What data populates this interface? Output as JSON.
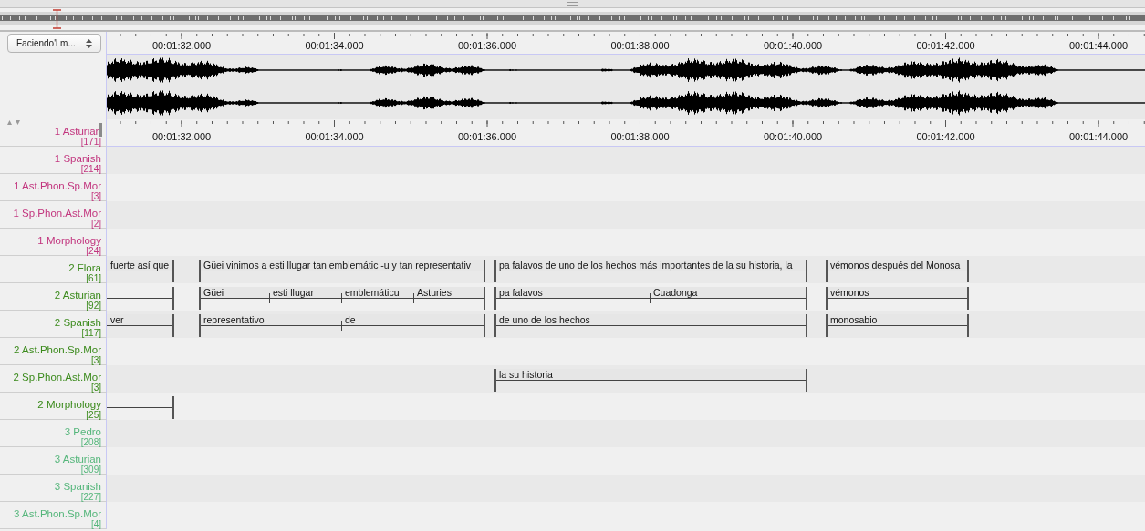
{
  "media_selector": {
    "value": "Faciendo'l m..."
  },
  "rulers": [
    {
      "ticks": [
        "00:01:32.000",
        "00:01:34.000",
        "00:01:36.000",
        "00:01:38.000",
        "00:01:40.000",
        "00:01:42.000",
        "00:01:44.000"
      ]
    },
    {
      "ticks": [
        "00:01:32.000",
        "00:01:34.000",
        "00:01:36.000",
        "00:01:38.000",
        "00:01:40.000",
        "00:01:42.000",
        "00:01:44.000"
      ]
    }
  ],
  "tiers": [
    {
      "name": "1 Asturian",
      "count": "[171]",
      "color": "#c2357e",
      "active": true
    },
    {
      "name": "1 Spanish",
      "count": "[214]",
      "color": "#c2357e",
      "active": false
    },
    {
      "name": "1 Ast.Phon.Sp.Mor",
      "count": "[3]",
      "color": "#c2357e",
      "active": false
    },
    {
      "name": "1 Sp.Phon.Ast.Mor",
      "count": "[2]",
      "color": "#c2357e",
      "active": false
    },
    {
      "name": "1 Morphology",
      "count": "[24]",
      "color": "#c2357e",
      "active": false
    },
    {
      "name": "2 Flora",
      "count": "[61]",
      "color": "#3b8a1c",
      "active": false,
      "annotations": [
        {
          "text": "fuerte así que"
        },
        {
          "text": "Güei vinimos a esti llugar tan emblemátic -u y tan representativ"
        },
        {
          "text": "pa falavos de uno de los hechos más importantes de la su historia, la"
        },
        {
          "text": "vémonos después del Monosa"
        }
      ]
    },
    {
      "name": "2 Asturian",
      "count": "[92]",
      "color": "#3b8a1c",
      "active": false,
      "annotations": [
        {
          "kind": "empty"
        },
        {
          "text": "Güei"
        },
        {
          "text": "esti llugar"
        },
        {
          "text": "emblemáticu"
        },
        {
          "text": "Asturies"
        },
        {
          "text": "pa falavos"
        },
        {
          "text": "Cuadonga"
        },
        {
          "text": "vémonos"
        }
      ]
    },
    {
      "name": "2 Spanish",
      "count": "[117]",
      "color": "#3b8a1c",
      "active": false,
      "annotations": [
        {
          "text": "ver"
        },
        {
          "text": "representativo"
        },
        {
          "text": "de"
        },
        {
          "text": "de uno de los hechos"
        },
        {
          "text": "monosabio"
        }
      ]
    },
    {
      "name": "2 Ast.Phon.Sp.Mor",
      "count": "[3]",
      "color": "#3b8a1c",
      "active": false
    },
    {
      "name": "2 Sp.Phon.Ast.Mor",
      "count": "[3]",
      "color": "#3b8a1c",
      "active": false,
      "annotations": [
        {
          "text": "la su historia"
        }
      ]
    },
    {
      "name": "2 Morphology",
      "count": "[25]",
      "color": "#3b8a1c",
      "active": false,
      "annotations": [
        {
          "kind": "empty"
        }
      ]
    },
    {
      "name": "3 Pedro",
      "count": "[208]",
      "color": "#55b67b",
      "active": false
    },
    {
      "name": "3 Asturian",
      "count": "[309]",
      "color": "#55b67b",
      "active": false
    },
    {
      "name": "3 Spanish",
      "count": "[227]",
      "color": "#55b67b",
      "active": false
    },
    {
      "name": "3 Ast.Phon.Sp.Mor",
      "count": "[4]",
      "color": "#55b67b",
      "active": false
    }
  ]
}
